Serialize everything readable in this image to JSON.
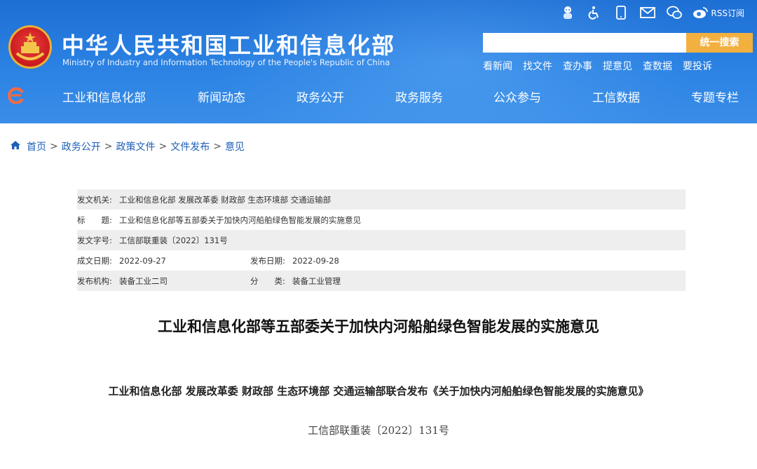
{
  "header": {
    "title": "中华人民共和国工业和信息化部",
    "subtitle": "Ministry of Industry and Information Technology of the People's Republic of China",
    "util_icons": [
      "robot-icon",
      "accessibility-icon",
      "mobile-icon",
      "mail-icon",
      "wechat-icon",
      "weibo-icon"
    ],
    "rss_label": "RSS订阅",
    "search": {
      "placeholder": "",
      "button": "统一搜索"
    },
    "quick_links": [
      "看新闻",
      "找文件",
      "查办事",
      "提意见",
      "查数据",
      "要投诉"
    ],
    "nav": [
      "工业和信息化部",
      "新闻动态",
      "政务公开",
      "政务服务",
      "公众参与",
      "工信数据",
      "专题专栏"
    ]
  },
  "breadcrumb": [
    "首页",
    "政务公开",
    "政策文件",
    "文件发布",
    "意见"
  ],
  "meta": {
    "issuer_label": "发文机关:",
    "issuer": "工业和信息化部 发展改革委 财政部 生态环境部 交通运输部",
    "title_label": "标　　题:",
    "title": "工业和信息化部等五部委关于加快内河船舶绿色智能发展的实施意见",
    "docno_label": "发文字号:",
    "docno": "工信部联重装〔2022〕131号",
    "created_label": "成文日期:",
    "created": "2022-09-27",
    "published_label": "发布日期:",
    "published": "2022-09-28",
    "org_label": "发布机构:",
    "org": "装备工业二司",
    "category_label": "分　　类:",
    "category": "装备工业管理"
  },
  "document": {
    "title": "工业和信息化部等五部委关于加快内河船舶绿色智能发展的实施意见",
    "subtitle": "工业和信息化部 发展改革委 财政部 生态环境部 交通运输部联合发布《关于加快内河船舶绿色智能发展的实施意见》",
    "number": "工信部联重装〔2022〕131号"
  },
  "colors": {
    "header_blue": "#2b82e3",
    "search_button": "#f2b03f",
    "link_blue": "#1d5fb8"
  }
}
